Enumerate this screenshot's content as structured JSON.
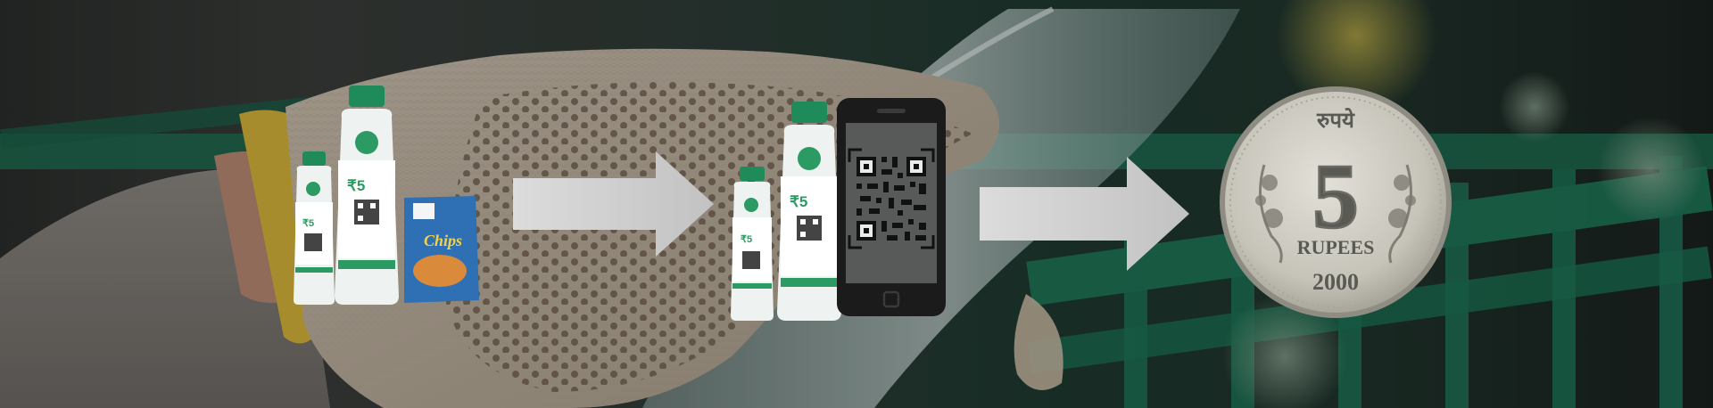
{
  "colors": {
    "crate_green": "#1f7a5a",
    "arrow_gray": "#d9d9d9",
    "brand_green": "#2c9a63",
    "phone_black": "#1b1b1b",
    "coin_silver": "#c9c7bf"
  },
  "bottle": {
    "price_label": "₹5"
  },
  "chips": {
    "brand_label": "Chips"
  },
  "coin": {
    "script_text": "रुपये",
    "value": "5",
    "unit": "RUPEES",
    "year": "2000"
  },
  "icons": {
    "arrow_1": "arrow-right-icon",
    "arrow_2": "arrow-right-icon",
    "phone": "smartphone-icon",
    "qr": "qr-code-icon"
  }
}
